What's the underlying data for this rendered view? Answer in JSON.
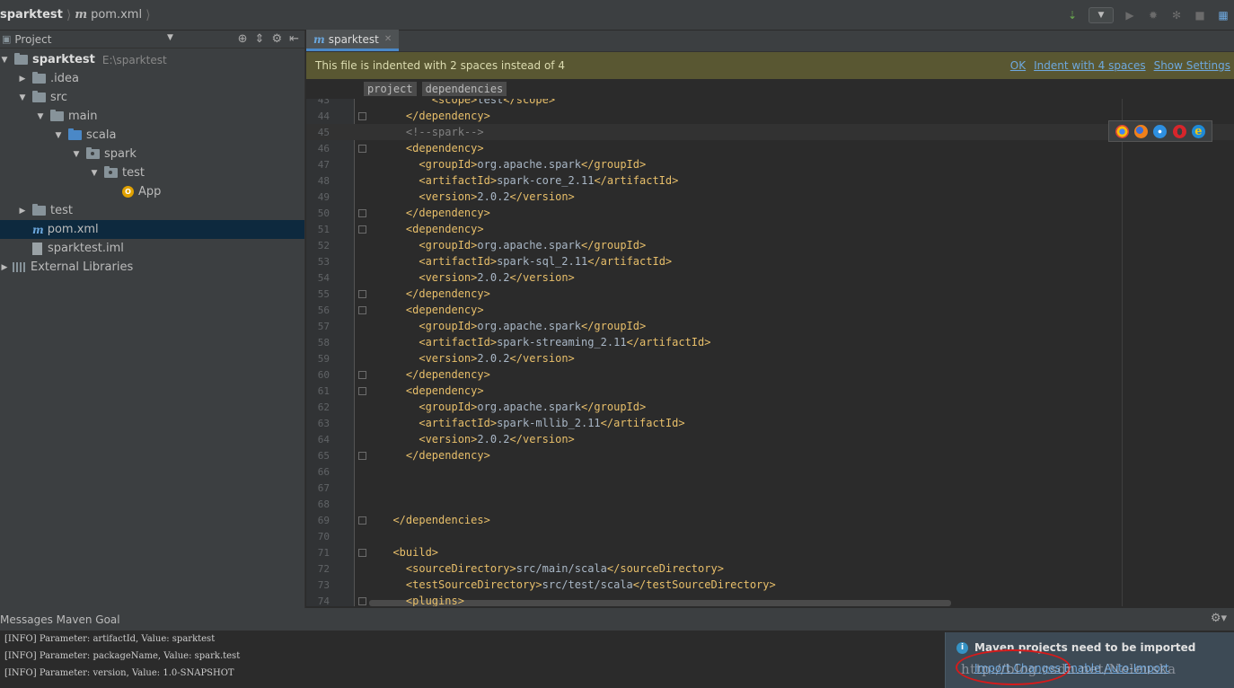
{
  "breadcrumb": {
    "project": "sparktest",
    "file": "pom.xml"
  },
  "sidebar": {
    "title": "Project",
    "tree": [
      {
        "label": "sparktest",
        "path": "E:\\sparktest",
        "depth": 0,
        "arrow": "▼",
        "icon": "module-folder-icon"
      },
      {
        "label": ".idea",
        "depth": 1,
        "arrow": "▶",
        "icon": "folder-icon"
      },
      {
        "label": "src",
        "depth": 1,
        "arrow": "▼",
        "icon": "folder-icon"
      },
      {
        "label": "main",
        "depth": 2,
        "arrow": "▼",
        "icon": "folder-icon"
      },
      {
        "label": "scala",
        "depth": 3,
        "arrow": "▼",
        "icon": "source-folder-icon"
      },
      {
        "label": "spark",
        "depth": 4,
        "arrow": "▼",
        "icon": "package-icon"
      },
      {
        "label": "test",
        "depth": 5,
        "arrow": "▼",
        "icon": "package-icon"
      },
      {
        "label": "App",
        "depth": 6,
        "arrow": "",
        "icon": "scala-object-icon"
      },
      {
        "label": "test",
        "depth": 1,
        "arrow": "▶",
        "icon": "folder-icon"
      },
      {
        "label": "pom.xml",
        "depth": 1,
        "arrow": "",
        "icon": "maven-file-icon",
        "selected": true
      },
      {
        "label": "sparktest.iml",
        "depth": 1,
        "arrow": "",
        "icon": "iml-file-icon"
      },
      {
        "label": "External Libraries",
        "depth": 0,
        "arrow": "▶",
        "icon": "library-icon"
      }
    ]
  },
  "editor": {
    "tab": "sparktest",
    "banner": {
      "message": "This file is indented with 2 spaces instead of 4",
      "links": [
        "OK",
        "Indent with 4 spaces",
        "Show Settings"
      ]
    },
    "xml_breadcrumbs": [
      "project",
      "dependencies"
    ],
    "lines": [
      {
        "n": "43",
        "text": "        <scope>test</scope>"
      },
      {
        "n": "44",
        "text": "    </dependency>"
      },
      {
        "n": "45",
        "text": "    <!--spark-->"
      },
      {
        "n": "46",
        "text": "    <dependency>"
      },
      {
        "n": "47",
        "text": "      <groupId>org.apache.spark</groupId>"
      },
      {
        "n": "48",
        "text": "      <artifactId>spark-core_2.11</artifactId>"
      },
      {
        "n": "49",
        "text": "      <version>2.0.2</version>"
      },
      {
        "n": "50",
        "text": "    </dependency>"
      },
      {
        "n": "51",
        "text": "    <dependency>"
      },
      {
        "n": "52",
        "text": "      <groupId>org.apache.spark</groupId>"
      },
      {
        "n": "53",
        "text": "      <artifactId>spark-sql_2.11</artifactId>"
      },
      {
        "n": "54",
        "text": "      <version>2.0.2</version>"
      },
      {
        "n": "55",
        "text": "    </dependency>"
      },
      {
        "n": "56",
        "text": "    <dependency>"
      },
      {
        "n": "57",
        "text": "      <groupId>org.apache.spark</groupId>"
      },
      {
        "n": "58",
        "text": "      <artifactId>spark-streaming_2.11</artifactId>"
      },
      {
        "n": "59",
        "text": "      <version>2.0.2</version>"
      },
      {
        "n": "60",
        "text": "    </dependency>"
      },
      {
        "n": "61",
        "text": "    <dependency>"
      },
      {
        "n": "62",
        "text": "      <groupId>org.apache.spark</groupId>"
      },
      {
        "n": "63",
        "text": "      <artifactId>spark-mllib_2.11</artifactId>"
      },
      {
        "n": "64",
        "text": "      <version>2.0.2</version>"
      },
      {
        "n": "65",
        "text": "    </dependency>"
      },
      {
        "n": "66",
        "text": ""
      },
      {
        "n": "67",
        "text": ""
      },
      {
        "n": "68",
        "text": ""
      },
      {
        "n": "69",
        "text": "  </dependencies>"
      },
      {
        "n": "70",
        "text": ""
      },
      {
        "n": "71",
        "text": "  <build>"
      },
      {
        "n": "72",
        "text": "    <sourceDirectory>src/main/scala</sourceDirectory>"
      },
      {
        "n": "73",
        "text": "    <testSourceDirectory>src/test/scala</testSourceDirectory>"
      },
      {
        "n": "74",
        "text": "    <plugins>"
      }
    ],
    "browser_icons": [
      "chrome-icon",
      "firefox-icon",
      "safari-icon",
      "opera-icon",
      "ie-icon"
    ]
  },
  "bottom_panel": {
    "title": "Messages Maven Goal",
    "log": [
      "[INFO] Parameter: artifactId, Value: sparktest",
      "[INFO] Parameter: packageName, Value: spark.test",
      "[INFO] Parameter: version, Value: 1.0-SNAPSHOT"
    ]
  },
  "notification": {
    "title": "Maven projects need to be imported",
    "link": "Import Changes  Enable Auto-Import"
  },
  "watermark": "http://blog.csdn.net/Neleuska"
}
